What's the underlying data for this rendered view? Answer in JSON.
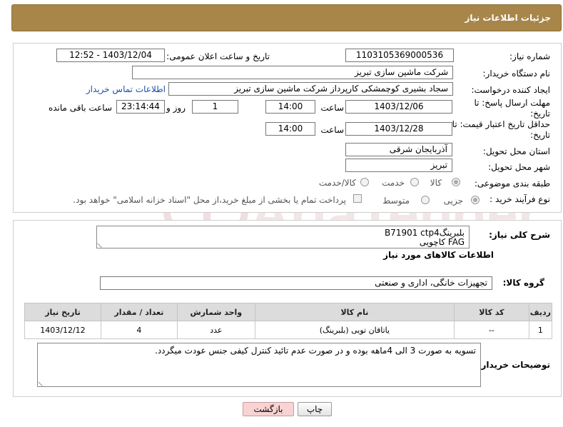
{
  "header": {
    "title": "جزئیات اطلاعات نیاز"
  },
  "form": {
    "need_number_label": "شماره نیاز:",
    "need_number": "1103105369000536",
    "announce_label": "تاریخ و ساعت اعلان عمومی:",
    "announce_value": "1403/12/04 - 12:52",
    "buyer_org_label": "نام دستگاه خریدار:",
    "buyer_org": "شرکت ماشین سازی تبریز",
    "creator_label": "ایجاد کننده درخواست:",
    "creator": "سجاد بشیری کوچمشکی کارپرداز شرکت ماشین سازی تبریز",
    "contact_link": "اطلاعات تماس خریدار",
    "deadline_label": "مهلت ارسال پاسخ: تا تاریخ:",
    "deadline_date": "1403/12/06",
    "time_label": "ساعت",
    "deadline_time": "14:00",
    "days_value": "1",
    "days_label": "روز و",
    "remaining_value": "23:14:44",
    "remaining_label": "ساعت باقی مانده",
    "validity_label": "حداقل تاریخ اعتبار قیمت: تا تاریخ:",
    "validity_date": "1403/12/28",
    "validity_time": "14:00",
    "province_label": "استان محل تحویل:",
    "province": "آذربایجان شرقی",
    "city_label": "شهر محل تحویل:",
    "city": "تبریز",
    "category_label": "طبقه بندی موضوعی:",
    "category_options": [
      "کالا",
      "خدمت",
      "کالا/خدمت"
    ],
    "purchase_type_label": "نوع فرآیند خرید :",
    "purchase_options": [
      "جزیی",
      "متوسط"
    ],
    "payment_note": "پرداخت تمام یا بخشی از مبلغ خرید،از محل \"اسناد خزانه اسلامی\" خواهد بود."
  },
  "details": {
    "summary_label": "شرح کلی نیاز:",
    "summary_line1": "بلبرینگB71901 ctp4",
    "summary_line2": "FAG  کاچویی",
    "goods_info_title": "اطلاعات کالاهای مورد نیاز",
    "goods_group_label": "گروه کالا:",
    "goods_group": "تجهیزات خانگی، اداری و صنعتی",
    "buyer_notes_label": "توضیحات خریدار:",
    "buyer_notes": "تسویه به صورت 3 الی 4ماهه بوده و در صورت عدم تائید کنترل کیفی جنس عودت میگردد."
  },
  "table": {
    "headers": [
      "ردیف",
      "کد کالا",
      "نام کالا",
      "واحد شمارش",
      "تعداد / مقدار",
      "تاریخ نیاز"
    ],
    "rows": [
      [
        "1",
        "--",
        "یاتاقان تویی (بلبرینگ)",
        "عدد",
        "4",
        "1403/12/12"
      ]
    ]
  },
  "buttons": {
    "print": "چاپ",
    "back": "بازگشت"
  },
  "colors": {
    "header_bg": "#a8864a",
    "link": "#1f4fa0",
    "back_button": "#f7d3d3"
  }
}
